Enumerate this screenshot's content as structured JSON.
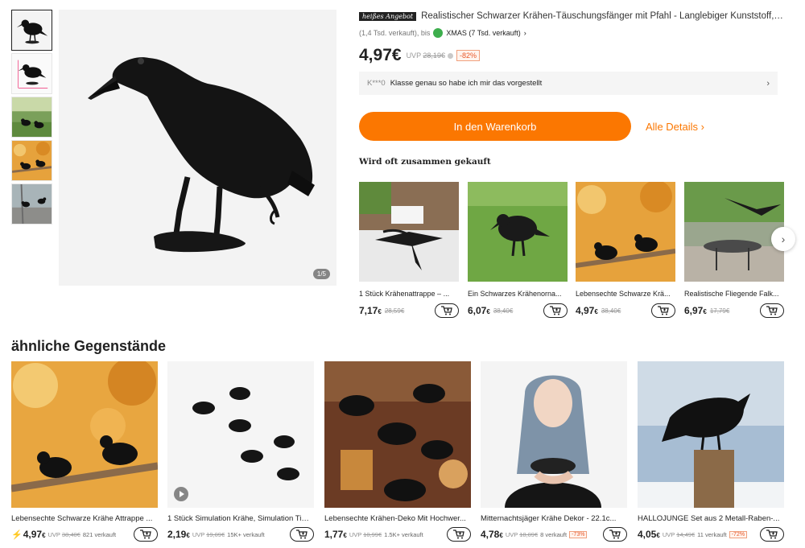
{
  "gallery": {
    "thumbnails": [
      "crow-front",
      "crow-diagram",
      "crows-garden",
      "crows-autumn",
      "crows-tree"
    ],
    "counter": "1/5"
  },
  "product": {
    "hot_badge": "heißes Angebot",
    "title": "Realistischer Schwarzer Krähen-Täuschungsfänger mit Pfahl - Langlebiger Kunststoff, Perfekt...",
    "sold_prefix": "(1,4 Tsd. verkauft), bis",
    "sold_xmas": "XMAS (7 Tsd. verkauft)",
    "sold_chevron": "›",
    "price": "4,97€",
    "uvp_label": "UVP",
    "uvp_price": "28,19€",
    "discount": "-82%",
    "review_user": "K***0",
    "review_text": "Klasse genau so habe ich mir das vorgestellt",
    "review_chevron": "›",
    "cart_button": "In den Warenkorb",
    "details_link": "Alle Details ›"
  },
  "together": {
    "title": "Wird oft zusammen gekauft",
    "items": [
      {
        "name": "1 Stück Krähenattrappe – ...",
        "price": "7,17",
        "currency": "€",
        "old": "28,59€"
      },
      {
        "name": "Ein Schwarzes Krähenorna...",
        "price": "6,07",
        "currency": "€",
        "old": "38,40€"
      },
      {
        "name": "Lebensechte Schwarze Krä...",
        "price": "4,97",
        "currency": "€",
        "old": "38,40€"
      },
      {
        "name": "Realistische Fliegende Falk...",
        "price": "6,97",
        "currency": "€",
        "old": "17,79€"
      }
    ],
    "next_arrow": "›"
  },
  "similar": {
    "title": "ähnliche Gegenstände",
    "items": [
      {
        "name": "Lebensechte Schwarze Krähe Attrappe ...",
        "flash": "⚡",
        "price": "4,97",
        "currency": "€",
        "uvp_label": "UVP",
        "uvp": "38,40€",
        "sold": "821 verkauft",
        "discount": ""
      },
      {
        "name": "1 Stück Simulation Krähe, Simulation Tie...",
        "flash": "",
        "price": "2,19",
        "currency": "€",
        "uvp_label": "UVP",
        "uvp": "19,09€",
        "sold": "15K+ verkauft",
        "discount": ""
      },
      {
        "name": "Lebensechte Krähen-Deko Mit Hochwer...",
        "flash": "",
        "price": "1,77",
        "currency": "€",
        "uvp_label": "UVP",
        "uvp": "10,99€",
        "sold": "1.5K+ verkauft",
        "discount": ""
      },
      {
        "name": "Mitternachtsjäger Krähe Dekor - 22.1c...",
        "flash": "",
        "price": "4,78",
        "currency": "€",
        "uvp_label": "UVP",
        "uvp": "18,09€",
        "sold": "8 verkauft",
        "discount": "-73%"
      },
      {
        "name": "HALLOJUNGE Set aus 2 Metall-Raben-...",
        "flash": "",
        "price": "4,05",
        "currency": "€",
        "uvp_label": "UVP",
        "uvp": "14,49€",
        "sold": "11 verkauft",
        "discount": "-72%"
      }
    ]
  },
  "colors": {
    "accent": "#fb7701",
    "discount": "#e8582a",
    "text": "#222222"
  }
}
